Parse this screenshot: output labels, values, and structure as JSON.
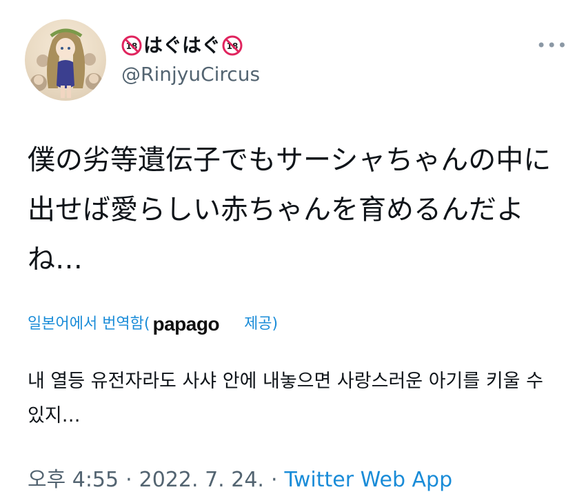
{
  "user": {
    "display_name": "はぐはぐ",
    "handle": "@RinjyuCircus",
    "badge_left_icon": "no-under-18-icon",
    "badge_right_icon": "no-under-18-icon"
  },
  "tweet": {
    "text": "僕の劣等遺伝子でもサーシャちゃんの中に出せば愛らしい赤ちゃんを育めるんだよね…"
  },
  "translation": {
    "label_prefix": "일본어에서 번역함(",
    "provider": "papago",
    "label_suffix": "제공)",
    "text": "내 열등 유전자라도 사샤 안에 내놓으면 사랑스러운 아기를 키울 수 있지…"
  },
  "meta": {
    "time": "오후 4:55",
    "sep1": "·",
    "date": "2022. 7. 24.",
    "sep2": "·",
    "source": "Twitter Web App"
  },
  "colors": {
    "link": "#1a8cd8",
    "secondary": "#536471",
    "text": "#0f1419"
  }
}
